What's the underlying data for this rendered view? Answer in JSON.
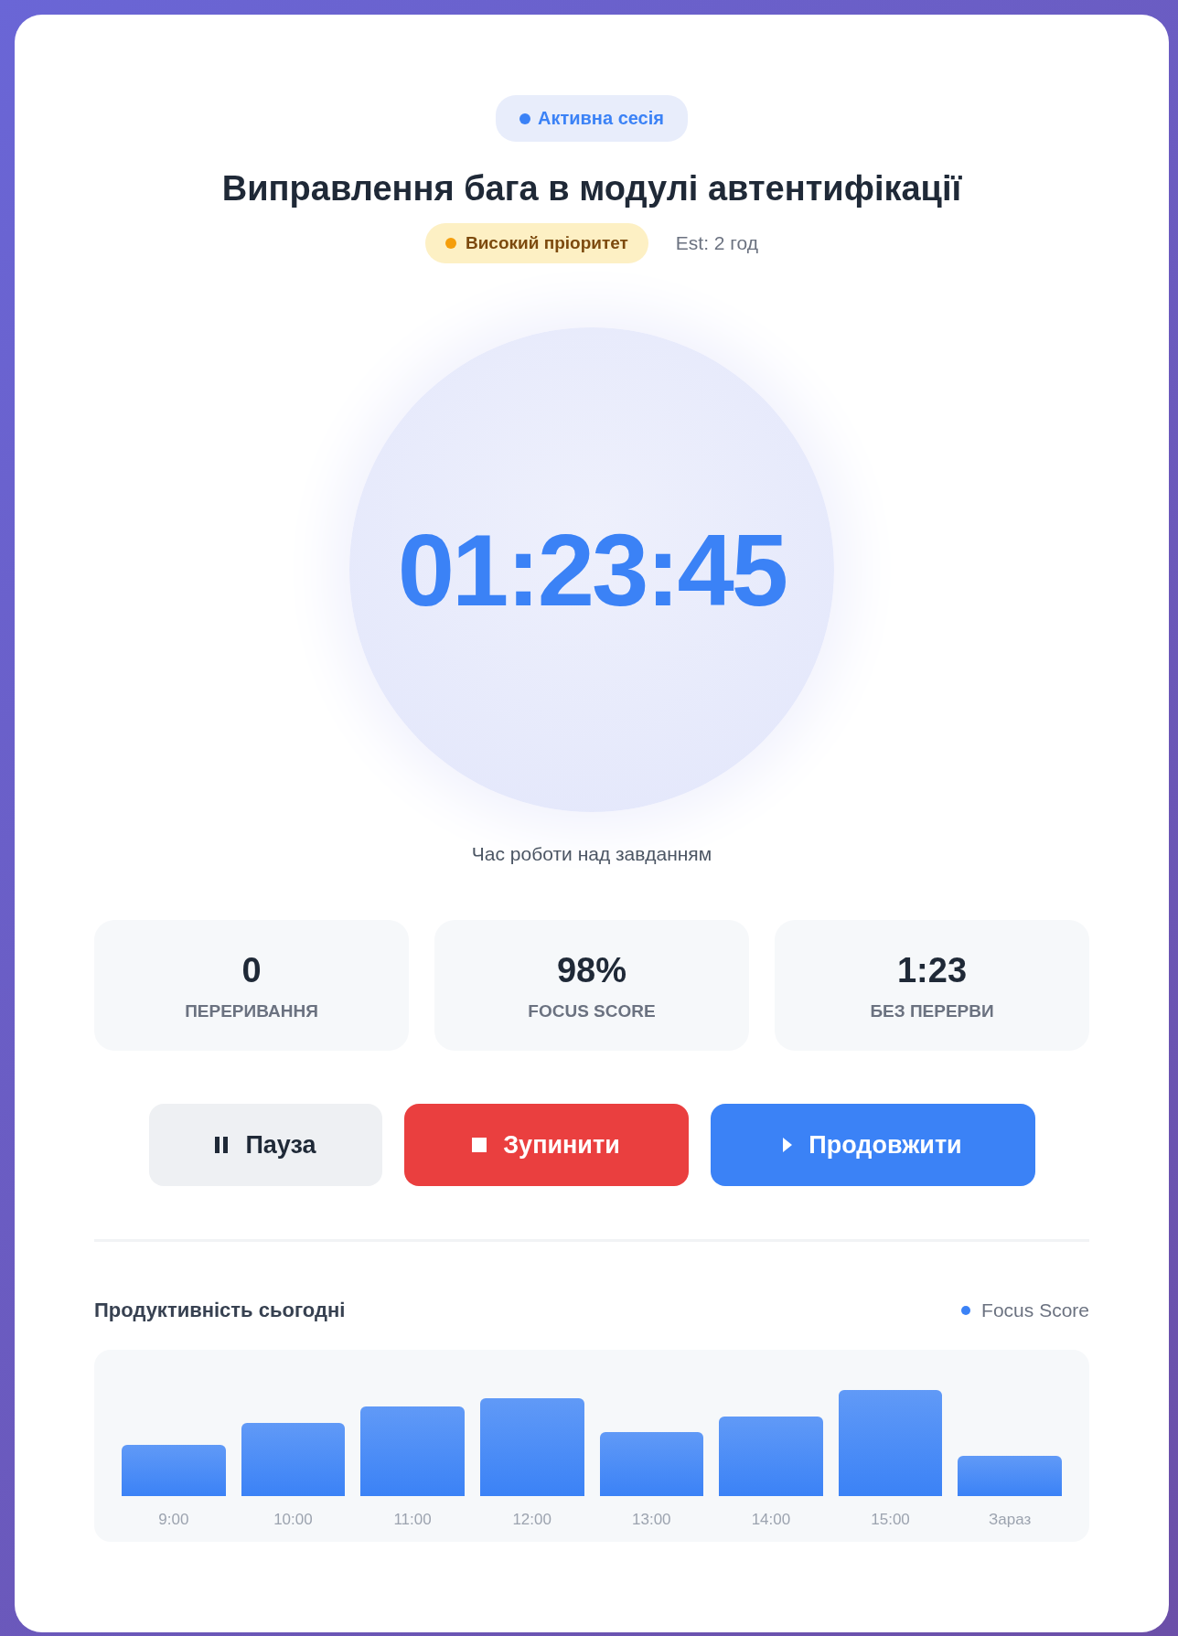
{
  "session_badge": {
    "label": "Активна сесія",
    "color": "#3b82f6"
  },
  "task": {
    "title": "Виправлення бага в модулі автентифікації",
    "priority": {
      "label": "Високий пріоритет",
      "color": "#f59e0b"
    },
    "estimate": "Est: 2 год"
  },
  "timer": {
    "time": "01:23:45",
    "caption": "Час роботи над завданням"
  },
  "stats": [
    {
      "value": "0",
      "label": "ПЕРЕРИВАННЯ"
    },
    {
      "value": "98%",
      "label": "FOCUS SCORE"
    },
    {
      "value": "1:23",
      "label": "БЕЗ ПЕРЕРВИ"
    }
  ],
  "buttons": [
    {
      "kind": "pause",
      "label": "Пауза"
    },
    {
      "kind": "stop",
      "label": "Зупинити"
    },
    {
      "kind": "play",
      "label": "Продовжити"
    }
  ],
  "productivity": {
    "title": "Продуктивність сьогодні",
    "legend": {
      "label": "Focus Score",
      "color": "#3b82f6"
    },
    "categories": [
      "9:00",
      "10:00",
      "11:00",
      "12:00",
      "13:00",
      "14:00",
      "15:00",
      "Зараз"
    ]
  }
}
